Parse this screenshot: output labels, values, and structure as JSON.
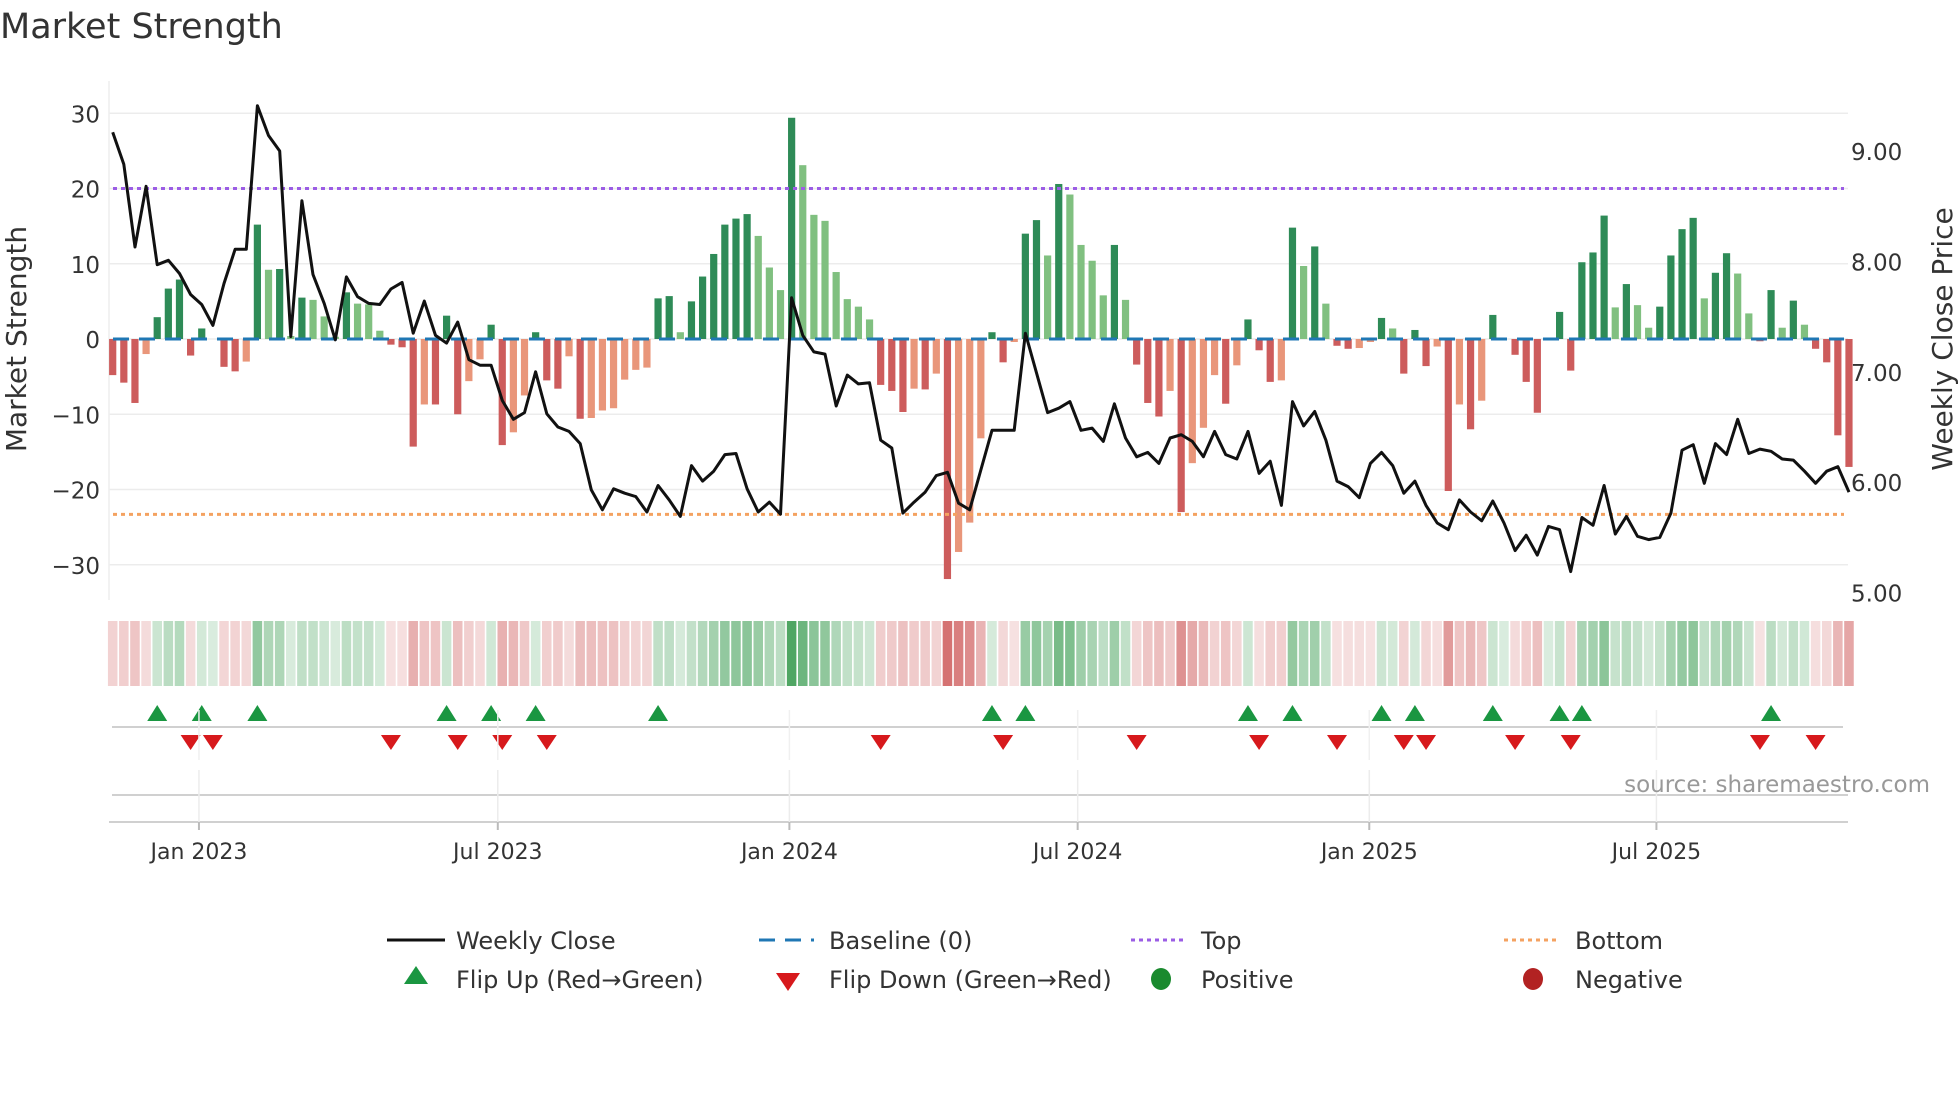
{
  "chart_data": {
    "type": "bar",
    "title": "Market Strength",
    "ylabel": "Market Strength",
    "y2label": "Weekly Close Price",
    "ylim": [
      -36,
      33
    ],
    "y2lim": [
      4.9,
      9.4
    ],
    "yticks": [
      30,
      20,
      10,
      0,
      -10,
      -20,
      -30
    ],
    "yticklabels": [
      "30",
      "20",
      "10",
      "0",
      "−10",
      "−20",
      "−30"
    ],
    "y2ticks": [
      9,
      8,
      7,
      6,
      5
    ],
    "y2ticklabels": [
      "9.00",
      "8.00",
      "7.00",
      "6.00",
      "5.00"
    ],
    "xticks": [
      {
        "label": "Jan 2023",
        "week_index": 7.75
      },
      {
        "label": "Jul 2023",
        "week_index": 34.6
      },
      {
        "label": "Jan 2024",
        "week_index": 60.8
      },
      {
        "label": "Jul 2024",
        "week_index": 86.7
      },
      {
        "label": "Jan 2025",
        "week_index": 112.9
      },
      {
        "label": "Jul 2025",
        "week_index": 138.7
      }
    ],
    "top_level": 20,
    "bottom_level": -23.3,
    "baseline": 0,
    "strength": [
      -4.8,
      -5.8,
      -8.5,
      -2.0,
      2.9,
      6.7,
      7.9,
      -2.2,
      1.4,
      0,
      -3.7,
      -4.3,
      -3.0,
      15.2,
      9.2,
      9.3,
      0.4,
      5.5,
      5.2,
      3.0,
      0.3,
      6.2,
      4.7,
      4.6,
      1.1,
      -0.75,
      -1.1,
      -14.3,
      -8.7,
      -8.7,
      3.1,
      -10.0,
      -5.6,
      -2.7,
      1.9,
      -14.1,
      -12.4,
      -7.5,
      0.9,
      -5.5,
      -6.6,
      -2.3,
      -10.6,
      -10.5,
      -9.5,
      -9.2,
      -5.4,
      -4.1,
      -3.8,
      5.4,
      5.7,
      0.9,
      5.0,
      8.3,
      11.3,
      15.2,
      16.0,
      16.6,
      13.7,
      9.5,
      6.5,
      29.4,
      23.1,
      16.5,
      15.7,
      8.9,
      5.3,
      4.3,
      2.6,
      -6.1,
      -6.9,
      -9.7,
      -6.6,
      -6.7,
      -4.6,
      -31.9,
      -28.3,
      -24.4,
      -13.2,
      0.9,
      -3.1,
      -0.4,
      14.0,
      15.8,
      11.1,
      20.6,
      19.2,
      12.5,
      10.4,
      5.8,
      12.5,
      5.2,
      -3.4,
      -8.5,
      -10.3,
      -6.9,
      -23.0,
      -16.5,
      -11.8,
      -4.8,
      -8.6,
      -3.5,
      2.6,
      -1.5,
      -5.7,
      -5.5,
      14.8,
      9.7,
      12.3,
      4.7,
      -0.9,
      -1.3,
      -1.2,
      -0.4,
      2.8,
      1.4,
      -4.6,
      1.2,
      -3.6,
      -1.0,
      -20.2,
      -8.7,
      -12.0,
      -8.2,
      3.2,
      0,
      -2.1,
      -5.7,
      -9.8,
      0,
      3.6,
      -4.2,
      10.2,
      11.5,
      16.4,
      4.2,
      7.3,
      4.5,
      1.5,
      4.3,
      11.1,
      14.6,
      16.1,
      5.4,
      8.8,
      11.4,
      8.7,
      3.4,
      -0.3,
      6.5,
      1.5,
      5.1,
      1.9,
      -1.3,
      -3.1,
      -12.8,
      -17.0
    ],
    "weekly_close": [
      9.17,
      8.88,
      8.13,
      8.68,
      7.97,
      8.01,
      7.89,
      7.7,
      7.61,
      7.42,
      7.8,
      8.11,
      8.11,
      9.41,
      9.14,
      9.0,
      7.32,
      8.55,
      7.88,
      7.62,
      7.29,
      7.86,
      7.68,
      7.62,
      7.61,
      7.75,
      7.81,
      7.35,
      7.64,
      7.33,
      7.26,
      7.45,
      7.11,
      7.06,
      7.06,
      6.74,
      6.57,
      6.63,
      7.0,
      6.62,
      6.5,
      6.46,
      6.35,
      5.93,
      5.75,
      5.94,
      5.9,
      5.87,
      5.73,
      5.97,
      5.84,
      5.69,
      6.15,
      6.01,
      6.1,
      6.25,
      6.26,
      5.94,
      5.73,
      5.82,
      5.71,
      7.67,
      7.33,
      7.18,
      7.16,
      6.69,
      6.97,
      6.89,
      6.9,
      6.38,
      6.31,
      5.72,
      5.82,
      5.91,
      6.06,
      6.09,
      5.81,
      5.75,
      6.11,
      6.47,
      6.47,
      6.47,
      7.35,
      6.99,
      6.63,
      6.67,
      6.73,
      6.47,
      6.49,
      6.37,
      6.71,
      6.4,
      6.23,
      6.27,
      6.17,
      6.4,
      6.43,
      6.37,
      6.23,
      6.46,
      6.25,
      6.21,
      6.46,
      6.08,
      6.19,
      5.79,
      6.73,
      6.51,
      6.64,
      6.38,
      6.01,
      5.96,
      5.86,
      6.17,
      6.27,
      6.15,
      5.9,
      6.01,
      5.79,
      5.63,
      5.57,
      5.84,
      5.73,
      5.65,
      5.83,
      5.63,
      5.38,
      5.52,
      5.34,
      5.6,
      5.57,
      5.19,
      5.68,
      5.61,
      5.97,
      5.53,
      5.69,
      5.51,
      5.48,
      5.5,
      5.72,
      6.29,
      6.34,
      5.99,
      6.35,
      6.25,
      6.57,
      6.26,
      6.3,
      6.28,
      6.21,
      6.2,
      6.1,
      5.99,
      6.1,
      6.14,
      5.91
    ],
    "flip_up_weeks": [
      4,
      8,
      13,
      30,
      34,
      38,
      49,
      79,
      82,
      102,
      106,
      114,
      117,
      124,
      130,
      132,
      149
    ],
    "flip_down_weeks": [
      7,
      9,
      25,
      31,
      35,
      39,
      69,
      80,
      92,
      103,
      110,
      116,
      118,
      126,
      131,
      148,
      153
    ],
    "colors": {
      "pos_rising": "#2e8b57",
      "pos_falling": "#80c080",
      "neg_falling": "#cd5c5c",
      "neg_rising": "#e9967a",
      "line": "#111111",
      "baseline": "#1f77b4",
      "top": "#9b5de5",
      "bottom": "#f4a261",
      "flip_up": "#1a9641",
      "flip_down": "#d7191c",
      "positive": "#1a8a2e",
      "negative": "#b22222"
    },
    "source": "source: sharemaestro.com",
    "legend": {
      "placement": "bottom",
      "items": [
        {
          "label": "Weekly Close",
          "symbol": "line"
        },
        {
          "label": "Baseline (0)",
          "symbol": "dash"
        },
        {
          "label": "Top",
          "symbol": "dot-purple"
        },
        {
          "label": "Bottom",
          "symbol": "dot-orange"
        },
        {
          "label": "Flip Up (Red→Green)",
          "symbol": "triangle-up"
        },
        {
          "label": "Flip Down (Green→Red)",
          "symbol": "triangle-down"
        },
        {
          "label": "Positive",
          "symbol": "circle-green"
        },
        {
          "label": "Negative",
          "symbol": "circle-red"
        }
      ]
    }
  }
}
